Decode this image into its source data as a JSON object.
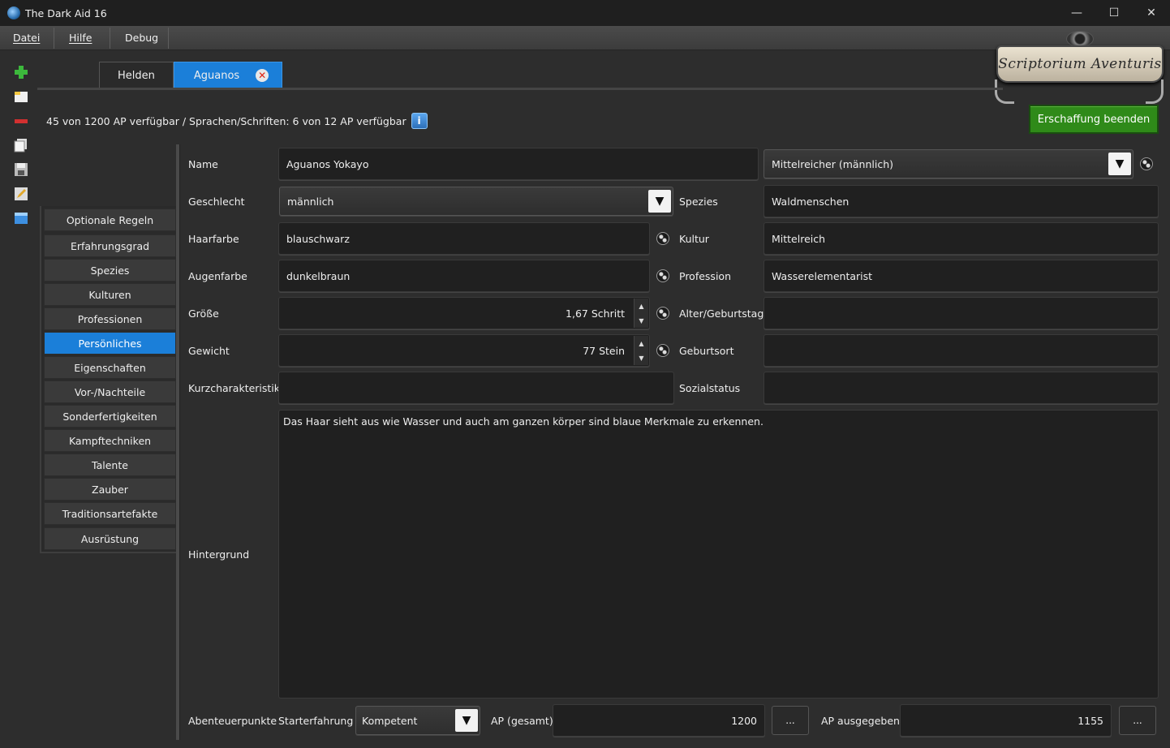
{
  "window": {
    "title": "The Dark Aid 16",
    "minimize": "—",
    "maximize": "☐",
    "close": "✕"
  },
  "menu": {
    "datei": "Datei",
    "hilfe": "Hilfe",
    "debug": "Debug"
  },
  "logo": {
    "text": "Scriptorium Aventuris"
  },
  "tabs": {
    "helden": "Helden",
    "aguanos": "Aguanos",
    "close_glyph": "✕"
  },
  "ap_info": {
    "text": "45 von 1200 AP verfügbar / Sprachen/Schriften: 6 von 12 AP verfügbar",
    "info_glyph": "i"
  },
  "finish_button": "Erschaffung beenden",
  "nav": {
    "items": [
      "Optionale Regeln",
      "Erfahrungsgrad",
      "Spezies",
      "Kulturen",
      "Professionen",
      "Persönliches",
      "Eigenschaften",
      "Vor-/Nachteile",
      "Sonderfertigkeiten",
      "Kampftechniken",
      "Talente",
      "Zauber",
      "Traditionsartefakte",
      "Ausrüstung"
    ],
    "active": "Persönliches"
  },
  "form": {
    "name_label": "Name",
    "name_value": "Aguanos Yokayo",
    "name_type_value": "Mittelreicher (männlich)",
    "gender_label": "Geschlecht",
    "gender_value": "männlich",
    "hair_label": "Haarfarbe",
    "hair_value": "blauschwarz",
    "eye_label": "Augenfarbe",
    "eye_value": "dunkelbraun",
    "size_label": "Größe",
    "size_value": "1,67 Schritt",
    "weight_label": "Gewicht",
    "weight_value": "77 Stein",
    "short_label": "Kurzcharakteristik",
    "short_value": "",
    "species_label": "Spezies",
    "species_value": "Waldmenschen",
    "culture_label": "Kultur",
    "culture_value": "Mittelreich",
    "profession_label": "Profession",
    "profession_value": "Wasserelementarist",
    "age_label": "Alter/Geburtstag",
    "age_value": "",
    "birthplace_label": "Geburtsort",
    "birthplace_value": "",
    "social_label": "Sozialstatus",
    "social_value": "",
    "background_label": "Hintergrund",
    "background_value": "Das Haar sieht aus wie Wasser und auch am ganzen körper sind blaue Merkmale zu erkennen."
  },
  "bottom": {
    "ap_label": "Abenteuerpunkte",
    "start_label": "Starterfahrung",
    "start_value": "Kompetent",
    "ap_total_label": "AP (gesamt)",
    "ap_total_value": "1200",
    "ap_spent_label": "AP ausgegeben",
    "ap_spent_value": "1155",
    "dots": "..."
  },
  "glyphs": {
    "arrow_down": "▼",
    "step_up": "▲",
    "step_down": "▼"
  },
  "colors": {
    "accent": "#1b7fd9",
    "finish": "#2f8a19",
    "background": "#2d2d2d"
  }
}
